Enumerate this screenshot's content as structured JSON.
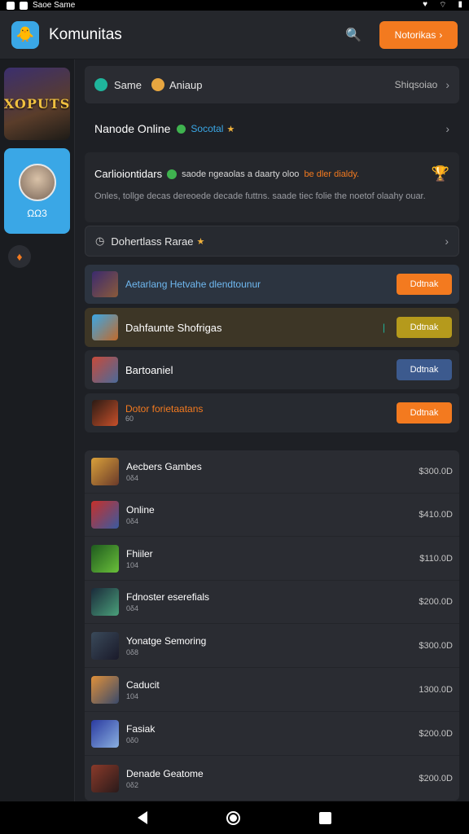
{
  "status_bar": {
    "app_name": "Saoe Same"
  },
  "header": {
    "title": "Komunitas",
    "notif_label": "Notorikas"
  },
  "rail": {
    "game_card_title": "XOPUTS",
    "avatar_badge": "ΩΩ3"
  },
  "section_rows": [
    {
      "label_a": "Same",
      "label_b": "Aniaup",
      "value": "Shiqsoiao"
    },
    {
      "title": "Nanode Online",
      "subtitle": "Socotal"
    }
  ],
  "featured": {
    "title": "Carlioiontidars",
    "headline": "saode ngeaolas a daarty oloo",
    "highlight": "be dler dialdy.",
    "body": "Onles, tollge decas dereoede decade futtns. saade tiec folie the noetof olaahy ouar."
  },
  "filter_row": {
    "label": "Dohertlass Rarae"
  },
  "promos": [
    {
      "title": "Aetarlang Hetvahe dlendtounur",
      "subtitle": "",
      "button": "Ddtnak",
      "accent": "#f37a1f",
      "bg": "#2c3440"
    },
    {
      "title": "Dahfaunte Shofrigas",
      "subtitle": "",
      "button": "Ddtnak",
      "accent": "#b59a1c",
      "bg": "#3d3626"
    },
    {
      "title": "Bartoaniel",
      "subtitle": "",
      "button": "Ddtnak",
      "accent": "#3c5a8e",
      "bg": "#272a30"
    },
    {
      "title": "Dotor forietaatans",
      "subtitle": "60",
      "button": "Ddtnak",
      "accent": "#f37a1f",
      "bg": "#272a30"
    }
  ],
  "games": [
    {
      "name": "Aecbers Gambes",
      "sub": "0δ4",
      "price": "$300.0D"
    },
    {
      "name": "Online",
      "sub": "0δ4",
      "price": "$410.0D"
    },
    {
      "name": "Fhiiler",
      "sub": "104",
      "price": "$110.0D"
    },
    {
      "name": "Fdnoster eserefials",
      "sub": "0δ4",
      "price": "$200.0D"
    },
    {
      "name": "Yonatge Semoring",
      "sub": "0δ8",
      "price": "$300.0D"
    },
    {
      "name": "Caducit",
      "sub": "104",
      "price": "1300.0D"
    },
    {
      "name": "Fasiak",
      "sub": "0δ0",
      "price": "$200.0D"
    },
    {
      "name": "Denade Geatome",
      "sub": "0δ2",
      "price": "$200.0D"
    }
  ]
}
